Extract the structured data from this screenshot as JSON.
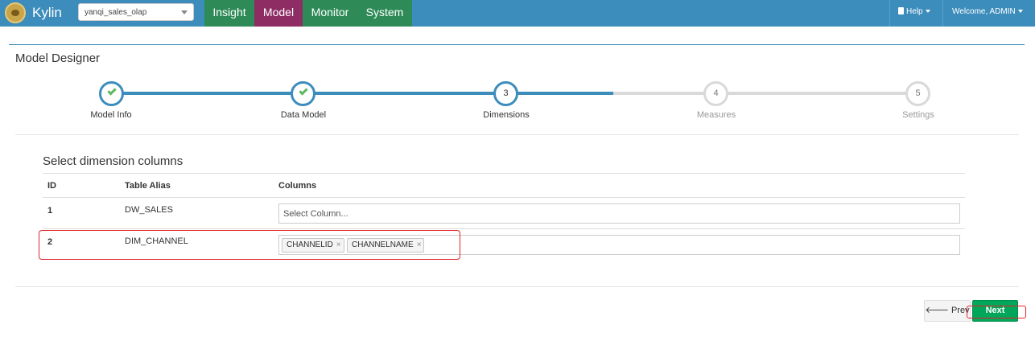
{
  "navbar": {
    "brand": "Kylin",
    "project": "yanqi_sales_olap",
    "tabs": [
      "Insight",
      "Model",
      "Monitor",
      "System"
    ],
    "help": "Help",
    "welcome": "Welcome, ADMIN"
  },
  "page": {
    "title": "Model Designer"
  },
  "wizard": {
    "steps": [
      {
        "number": "1",
        "label": "Model Info",
        "state": "done"
      },
      {
        "number": "2",
        "label": "Data Model",
        "state": "done"
      },
      {
        "number": "3",
        "label": "Dimensions",
        "state": "active"
      },
      {
        "number": "4",
        "label": "Measures",
        "state": "pending"
      },
      {
        "number": "5",
        "label": "Settings",
        "state": "pending"
      }
    ]
  },
  "dimensions": {
    "section_title": "Select dimension columns",
    "headers": {
      "id": "ID",
      "alias": "Table Alias",
      "columns": "Columns"
    },
    "rows": [
      {
        "id": "1",
        "alias": "DW_SALES",
        "placeholder": "Select Column...",
        "columns": []
      },
      {
        "id": "2",
        "alias": "DIM_CHANNEL",
        "placeholder": "",
        "columns": [
          "CHANNELID",
          "CHANNELNAME"
        ]
      }
    ]
  },
  "footer": {
    "prev_label": "Prev",
    "next_label": "Next"
  },
  "colors": {
    "navbar": "#3c8dbc",
    "active_tab": "#8e2d63",
    "tab": "#2e8b57",
    "next_button": "#00a65a",
    "highlight": "#e0262c"
  }
}
